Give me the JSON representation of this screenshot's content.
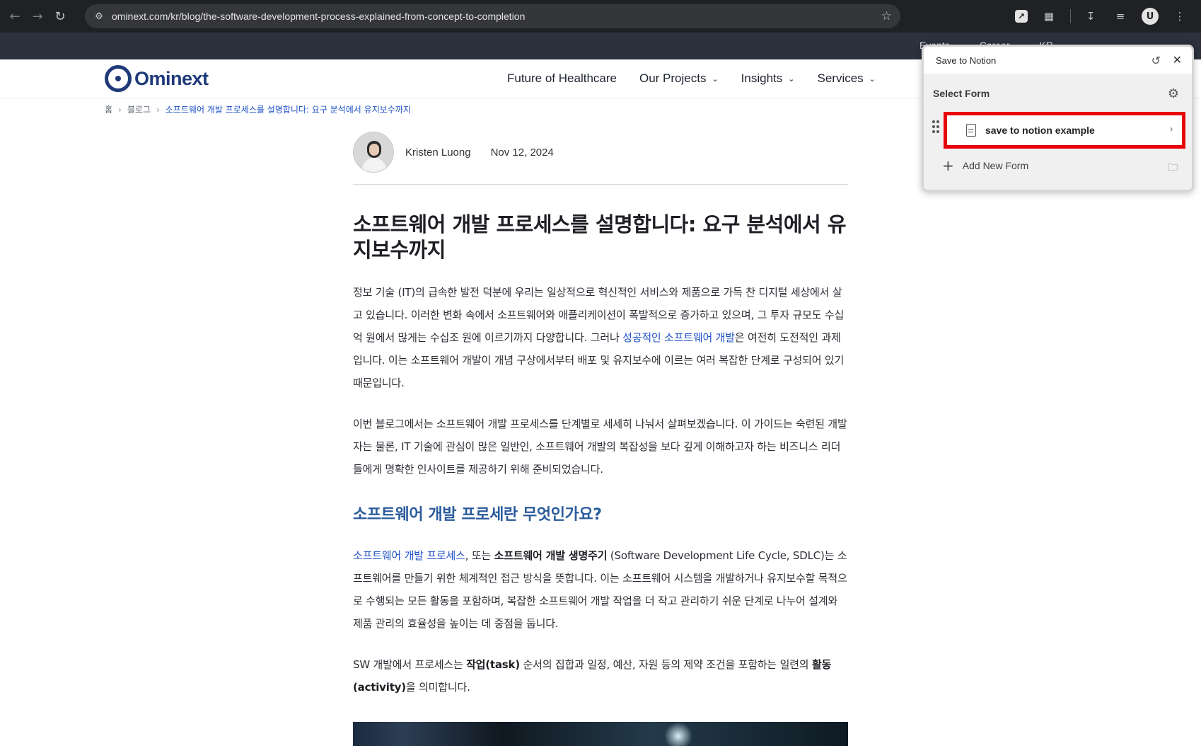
{
  "browser": {
    "url": "ominext.com/kr/blog/the-software-development-process-explained-from-concept-to-completion",
    "profile_initial": "U",
    "icons": [
      "back-icon",
      "forward-icon",
      "reload-icon",
      "site-info-icon",
      "bookmark-star-icon",
      "save-to-notion-extension-icon",
      "extensions-puzzle-icon",
      "download-icon",
      "media-queue-icon",
      "menu-kebab-icon"
    ]
  },
  "site": {
    "topbar_links": [
      "Events",
      "Career",
      "KR"
    ],
    "logo_text": "Ominext",
    "nav": [
      {
        "label": "Future of Healthcare",
        "has_dropdown": false
      },
      {
        "label": "Our Projects",
        "has_dropdown": true
      },
      {
        "label": "Insights",
        "has_dropdown": true
      },
      {
        "label": "Services",
        "has_dropdown": true
      }
    ]
  },
  "breadcrumb": {
    "home": "홈",
    "blog": "블로그",
    "current": "소프트웨어 개발 프로세스를 설명합니다: 요구 분석에서 유지보수까지"
  },
  "article": {
    "author": "Kristen Luong",
    "date": "Nov 12, 2024",
    "title": "소프트웨어 개발 프로세스를 설명합니다: 요구 분석에서 유지보수까지",
    "p1_a": "정보 기술 (IT)의 급속한 발전 덕분에 우리는 일상적으로 혁신적인 서비스와 제품으로 가득 찬 디지털 세상에서 살고 있습니다. 이러한 변화 속에서 소프트웨어와 애플리케이션이 폭발적으로 증가하고 있으며, 그 투자 규모도 수십억 원에서 많게는 수십조 원에 이르기까지 다양합니다. 그러나 ",
    "p1_link": "성공적인 소프트웨어 개발",
    "p1_b": "은 여전히 도전적인 과제입니다. 이는 소프트웨어 개발이 개념 구상에서부터 배포 및 유지보수에 이르는 여러 복잡한 단계로 구성되어 있기 때문입니다.",
    "p2": "이번 블로그에서는 소프트웨어 개발 프로세스를 단계별로 세세히 나눠서 살펴보겠습니다. 이 가이드는 숙련된 개발자는 물론, IT 기술에 관심이 많은 일반인, 소프트웨어 개발의 복잡성을 보다 깊게 이해하고자 하는 비즈니스 리더들에게 명확한 인사이트를 제공하기 위해 준비되었습니다.",
    "h2": "소프트웨어 개발 프로세란 무엇인가요?",
    "p3_link": "소프트웨어 개발 프로세스",
    "p3_a": ", 또는 ",
    "p3_bold": "소프트웨어 개발 생명주기",
    "p3_b": " (Software Development Life Cycle, SDLC)는 소프트웨어를 만들기 위한 체계적인 접근 방식을 뜻합니다. 이는 소프트웨어 시스템을 개발하거나 유지보수할 목적으로 수행되는 모든 활동을 포함하며, 복잡한 소프트웨어 개발 작업을 더 작고 관리하기 쉬운 단계로 나누어 설계와 제품 관리의 효율성을 높이는 데 중점을 둡니다.",
    "p4_a": "SW 개발에서 프로세스는 ",
    "p4_bold1": "작업(task)",
    "p4_b": " 순서의 집합과 일정, 예산, 자원 등의 제약 조건을 포함하는 일련의 ",
    "p4_bold2": "활동 (activity)",
    "p4_c": "을 의미합니다."
  },
  "popup": {
    "title": "Save to Notion",
    "select_label": "Select Form",
    "form_name": "save to notion example",
    "add_label": "Add New Form",
    "highlight_color": "#e8000b"
  }
}
